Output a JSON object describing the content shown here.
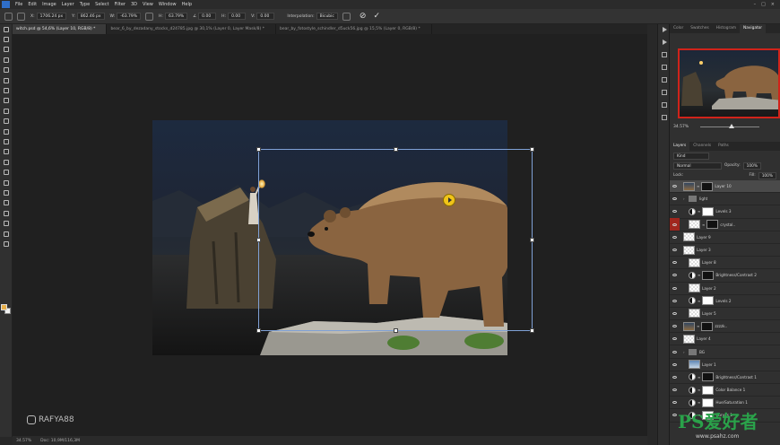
{
  "menu": {
    "items": [
      "File",
      "Edit",
      "Image",
      "Layer",
      "Type",
      "Select",
      "Filter",
      "3D",
      "View",
      "Window",
      "Help"
    ]
  },
  "options": {
    "x_label": "X:",
    "x_value": "1706.24 px",
    "y_label": "Y:",
    "y_value": "862.46 px",
    "w_label": "W:",
    "w_value": "-63.79%",
    "h_label": "H:",
    "h_value": "63.79%",
    "angle_value": "0.00",
    "hskew_label": "H:",
    "hskew_value": "0.00",
    "vskew_label": "V:",
    "vskew_value": "0.00",
    "interp_label": "Interpolation:",
    "interp_value": "Bicubic"
  },
  "tabs": [
    "witch.psd @ 54,6% (Layer 10, RGB/8) *",
    "bear_6_by_dezadany_stocks_d24785.jpg @ 30,1% (Layer 0, Layer Mask/8) *",
    "bear_by_fotostyle_schindler_d5uck56.jpg @ 15,5% (Layer 0, RGB/8) *"
  ],
  "status": {
    "zoom": "34.57%",
    "doc": "Doc: 10,9M/116,3M"
  },
  "watermark": {
    "handle": "RAFYA88",
    "ps_logo": "PS爱好者",
    "ps_url": "www.psahz.com"
  },
  "panels": {
    "top_tabs": [
      "Color",
      "Swatches",
      "Histogram",
      "Navigator"
    ],
    "navigator_zoom": "34.57%",
    "layer_tabs": [
      "Layers",
      "Channels",
      "Paths"
    ],
    "kind_placeholder": "Kind",
    "blend_mode": "Normal",
    "opacity_label": "Opacity:",
    "opacity_value": "100%",
    "lock_label": "Lock:",
    "fill_label": "Fill:",
    "fill_value": "100%"
  },
  "layers": [
    {
      "name": "Layer 10",
      "thumb": "photo",
      "mask": "black",
      "selected": true,
      "chain": true,
      "indent": false
    },
    {
      "name": "light",
      "thumb": "folder",
      "mask": "",
      "selected": false,
      "chain": false,
      "indent": false,
      "group": true
    },
    {
      "name": "Levels 3",
      "thumb": "adj",
      "mask": "white",
      "selected": false,
      "chain": true,
      "indent": true
    },
    {
      "name": "crystal..",
      "thumb": "checker",
      "mask": "black",
      "selected": false,
      "chain": true,
      "indent": true,
      "red_eye": true
    },
    {
      "name": "Layer 9",
      "thumb": "checker",
      "mask": "",
      "selected": false,
      "chain": false,
      "indent": false
    },
    {
      "name": "Layer 3",
      "thumb": "checker",
      "mask": "",
      "selected": false,
      "chain": false,
      "indent": false
    },
    {
      "name": "Layer 8",
      "thumb": "checker",
      "mask": "",
      "selected": false,
      "chain": false,
      "indent": true
    },
    {
      "name": "Brightness/Contrast 2",
      "thumb": "adj",
      "mask": "black",
      "selected": false,
      "chain": true,
      "indent": true
    },
    {
      "name": "Layer 2",
      "thumb": "checker",
      "mask": "",
      "selected": false,
      "chain": false,
      "indent": true
    },
    {
      "name": "Levels 2",
      "thumb": "adj",
      "mask": "white",
      "selected": false,
      "chain": true,
      "indent": true
    },
    {
      "name": "Layer 5",
      "thumb": "checker",
      "mask": "",
      "selected": false,
      "chain": false,
      "indent": true
    },
    {
      "name": "zzzzk..",
      "thumb": "photo",
      "mask": "black",
      "selected": false,
      "chain": true,
      "indent": false
    },
    {
      "name": "Layer 4",
      "thumb": "checker",
      "mask": "",
      "selected": false,
      "chain": false,
      "indent": false
    },
    {
      "name": "BG",
      "thumb": "folder",
      "mask": "",
      "selected": false,
      "chain": false,
      "indent": false,
      "group": true
    },
    {
      "name": "Layer 1",
      "thumb": "sky",
      "mask": "",
      "selected": false,
      "chain": false,
      "indent": true
    },
    {
      "name": "Brightness/Contrast 1",
      "thumb": "adj",
      "mask": "black",
      "selected": false,
      "chain": true,
      "indent": true
    },
    {
      "name": "Color Balance 1",
      "thumb": "adj",
      "mask": "white",
      "selected": false,
      "chain": true,
      "indent": true
    },
    {
      "name": "Hue/Saturation 1",
      "thumb": "adj",
      "mask": "white",
      "selected": false,
      "chain": true,
      "indent": true
    },
    {
      "name": "Curves 1",
      "thumb": "adj",
      "mask": "white",
      "selected": false,
      "chain": true,
      "indent": true
    }
  ],
  "colors": {
    "accent_red": "#d0231a",
    "selection_blue": "#7fa1d6",
    "fg_swatch": "#e8b04b"
  }
}
